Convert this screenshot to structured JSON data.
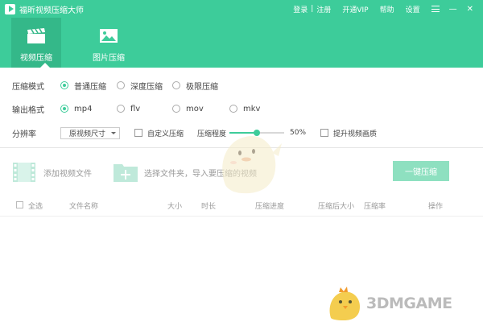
{
  "titlebar": {
    "app_title": "福昕视频压缩大师",
    "login": "登录",
    "separator": "|",
    "register": "注册",
    "vip": "开通VIP",
    "help": "帮助",
    "settings": "设置",
    "minimize": "—",
    "close": "✕"
  },
  "tabs": [
    {
      "label": "视频压缩",
      "icon": "clapperboard-icon",
      "active": true
    },
    {
      "label": "图片压缩",
      "icon": "image-icon",
      "active": false
    }
  ],
  "options": {
    "mode_label": "压缩模式",
    "modes": [
      {
        "label": "普通压缩",
        "selected": true
      },
      {
        "label": "深度压缩",
        "selected": false
      },
      {
        "label": "极限压缩",
        "selected": false
      }
    ],
    "format_label": "输出格式",
    "formats": [
      {
        "label": "mp4",
        "selected": true
      },
      {
        "label": "flv",
        "selected": false
      },
      {
        "label": "mov",
        "selected": false
      },
      {
        "label": "mkv",
        "selected": false
      }
    ],
    "resolution_label": "分辨率",
    "resolution_value": "原视频尺寸",
    "custom_compress_label": "自定义压缩",
    "degree_label": "压缩程度",
    "degree_value": "50%",
    "degree_fraction": 0.5,
    "enhance_label": "提升视频画质"
  },
  "actions": {
    "add_video": "添加视频文件",
    "select_folder": "选择文件夹，导入要压缩的视频",
    "one_click": "一键压缩"
  },
  "table": {
    "select_all": "全选",
    "columns": [
      "文件名称",
      "大小",
      "时长",
      "压缩进度",
      "压缩后大小",
      "压缩率",
      "操作"
    ]
  },
  "watermark": {
    "brand": "3DMGAME"
  },
  "colors": {
    "accent": "#3dcc9a"
  }
}
